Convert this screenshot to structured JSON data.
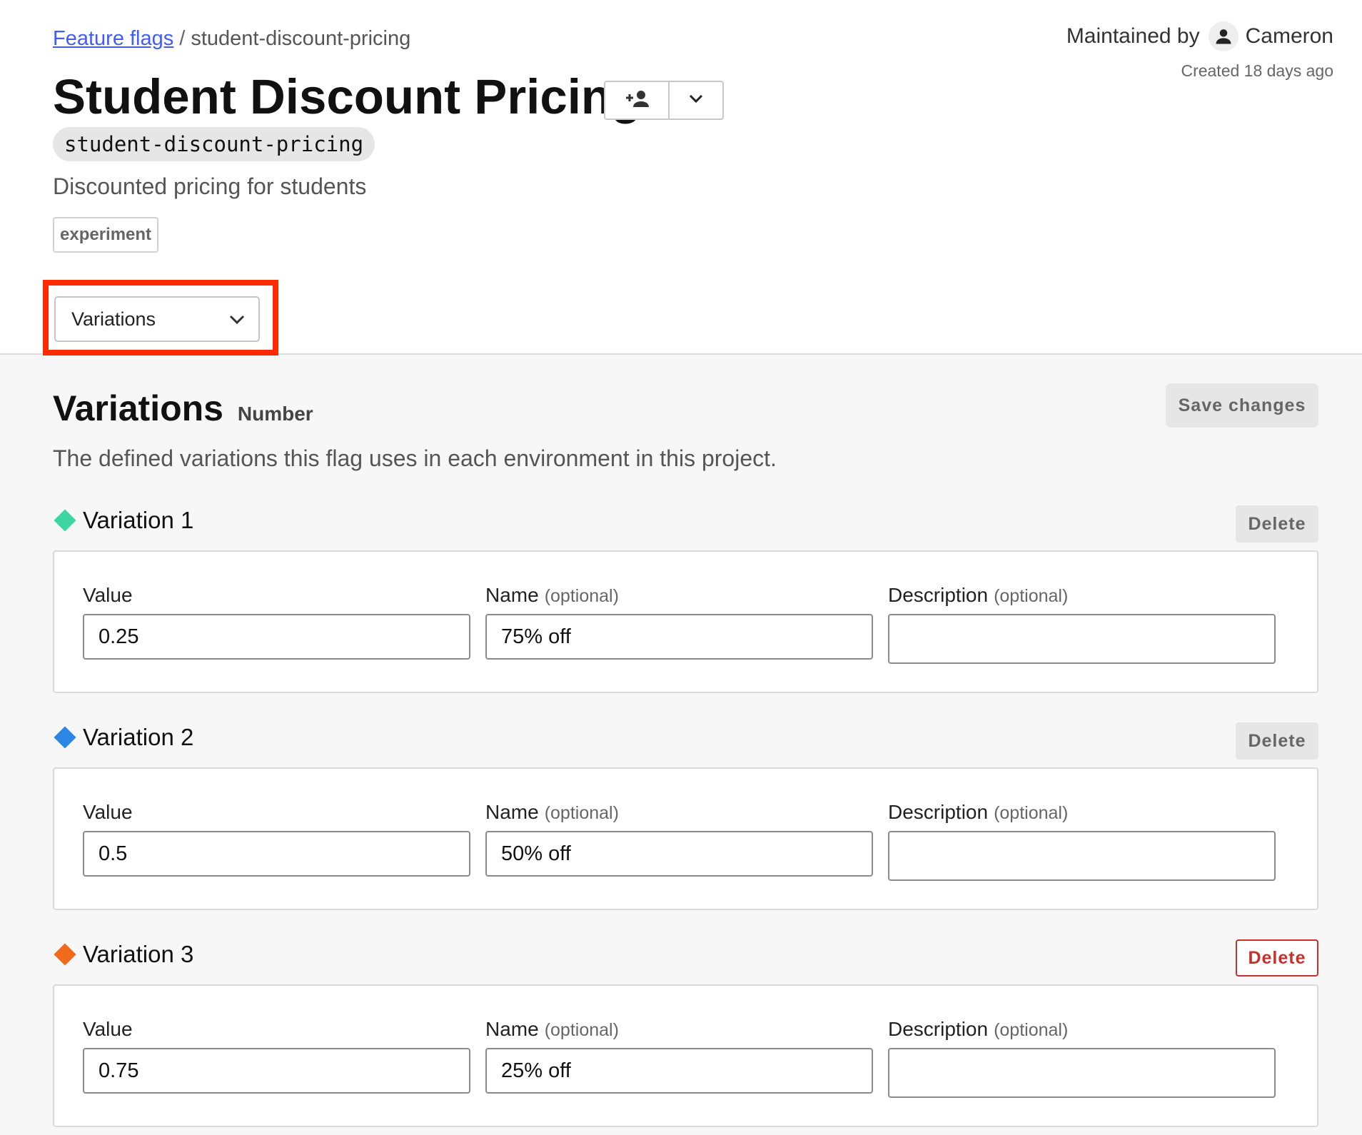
{
  "breadcrumb": {
    "link": "Feature flags",
    "separator": "/",
    "current": "student-discount-pricing"
  },
  "maintainer": {
    "label": "Maintained by",
    "name": "Cameron",
    "icon": "person-icon"
  },
  "created": "Created 18 days ago",
  "flag": {
    "title": "Student Discount Pricing",
    "key": "student-discount-pricing",
    "description": "Discounted pricing for students",
    "tag": "experiment"
  },
  "title_actions": {
    "add_maintainer_icon": "add-person-icon",
    "more_icon": "chevron-down-icon"
  },
  "view_select": {
    "value": "Variations",
    "icon": "chevron-down-icon"
  },
  "section": {
    "title": "Variations",
    "type": "Number",
    "description": "The defined variations this flag uses in each environment in this project.",
    "save_label": "Save changes"
  },
  "labels": {
    "value": "Value",
    "name": "Name",
    "description": "Description",
    "optional": "(optional)",
    "delete": "Delete"
  },
  "variations": [
    {
      "title": "Variation 1",
      "color": "#3dd6a3",
      "value": "0.25",
      "name": "75% off",
      "description": "",
      "delete_style": "neutral"
    },
    {
      "title": "Variation 2",
      "color": "#2b87e3",
      "value": "0.5",
      "name": "50% off",
      "description": "",
      "delete_style": "neutral"
    },
    {
      "title": "Variation 3",
      "color": "#f26a1b",
      "value": "0.75",
      "name": "25% off",
      "description": "",
      "delete_style": "danger"
    }
  ],
  "colors": {
    "link": "#405bff",
    "highlight": "#ff2a00",
    "danger": "#c9302c"
  }
}
